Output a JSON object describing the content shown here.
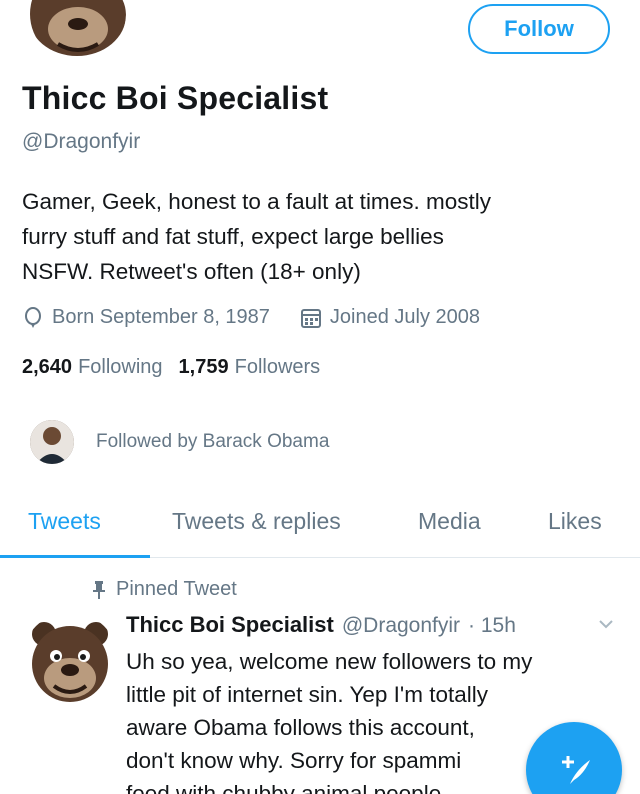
{
  "profile": {
    "display_name": "Thicc Boi Specialist",
    "handle": "@Dragonfyir",
    "bio_lines": [
      "Gamer, Geek, honest to a fault at times. mostly",
      "furry stuff and fat stuff, expect large bellies",
      "NSFW. Retweet's often (18+ only)"
    ],
    "born": "Born September 8, 1987",
    "joined": "Joined July 2008",
    "following_count": "2,640",
    "following_label": "Following",
    "followers_count": "1,759",
    "followers_label": "Followers",
    "followed_by": "Followed by Barack Obama"
  },
  "actions": {
    "follow_label": "Follow"
  },
  "tabs": [
    {
      "label": "Tweets",
      "active": true
    },
    {
      "label": "Tweets & replies",
      "active": false
    },
    {
      "label": "Media",
      "active": false
    },
    {
      "label": "Likes",
      "active": false
    }
  ],
  "tweet": {
    "pinned_label": "Pinned Tweet",
    "author_name": "Thicc Boi Specialist",
    "author_handle": "@Dragonfyir",
    "time": "· 15h",
    "lines": [
      "Uh so yea, welcome new followers to my",
      "little pit of internet sin. Yep I'm totally",
      "aware Obama follows this account,",
      "don't know why. Sorry for spammi",
      "feed with chubby animal people"
    ]
  },
  "icons": {
    "birthday": "balloon-icon",
    "joined": "calendar-icon",
    "pin": "pin-icon",
    "caret": "chevron-down-icon",
    "compose": "compose-icon"
  },
  "colors": {
    "accent": "#1da1f2",
    "secondary_text": "#657786",
    "primary_text": "#14171a"
  }
}
